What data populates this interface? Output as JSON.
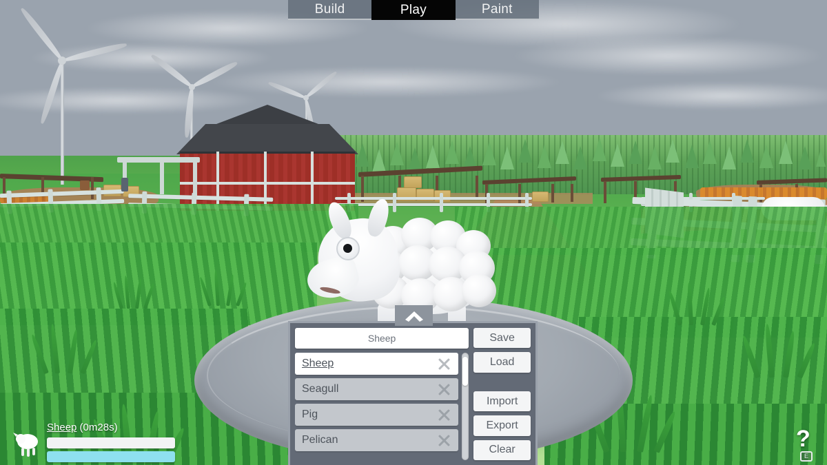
{
  "topbar": {
    "tabs": [
      {
        "label": "Build",
        "selected": false
      },
      {
        "label": "Play",
        "selected": true
      },
      {
        "label": "Paint",
        "selected": false
      }
    ]
  },
  "panel": {
    "collapse_icon": "chevron-up-icon",
    "name_field": {
      "value": "Sheep",
      "placeholder": "Sheep"
    },
    "items": [
      {
        "label": "Sheep",
        "selected": true,
        "delete_icon": "close-icon"
      },
      {
        "label": "Seagull",
        "selected": false,
        "delete_icon": "close-icon"
      },
      {
        "label": "Pig",
        "selected": false,
        "delete_icon": "close-icon"
      },
      {
        "label": "Pelican",
        "selected": false,
        "delete_icon": "close-icon"
      }
    ],
    "scrollbar": {
      "thumb_position_pct": 4
    },
    "buttons_top": [
      {
        "label": "Save"
      },
      {
        "label": "Load"
      }
    ],
    "buttons_bottom": [
      {
        "label": "Import"
      },
      {
        "label": "Export"
      },
      {
        "label": "Clear"
      }
    ]
  },
  "hud": {
    "creature_name": "Sheep",
    "timer": "(0m28s)",
    "bar_primary_pct": 100,
    "bar_secondary_pct": 100,
    "bar_secondary_color": "#8ee0ef",
    "avatar_icon": "sheep-icon"
  },
  "help": {
    "icon": "question-mark-icon",
    "key_hint": "E"
  },
  "scene": {
    "description": "low-poly farm with red barn, wind turbines, white fences, crop fields and pine forest",
    "sky_top_color": "#9aa6b4",
    "sky_bottom_color": "#e9e6dc",
    "grass_color": "#55ad4e",
    "barn_color": "#a53429",
    "barn_roof_color": "#3c3f44",
    "path_color": "#b5875e",
    "platform_color": "#a2a9b1",
    "creature_color": "#ffffff"
  }
}
